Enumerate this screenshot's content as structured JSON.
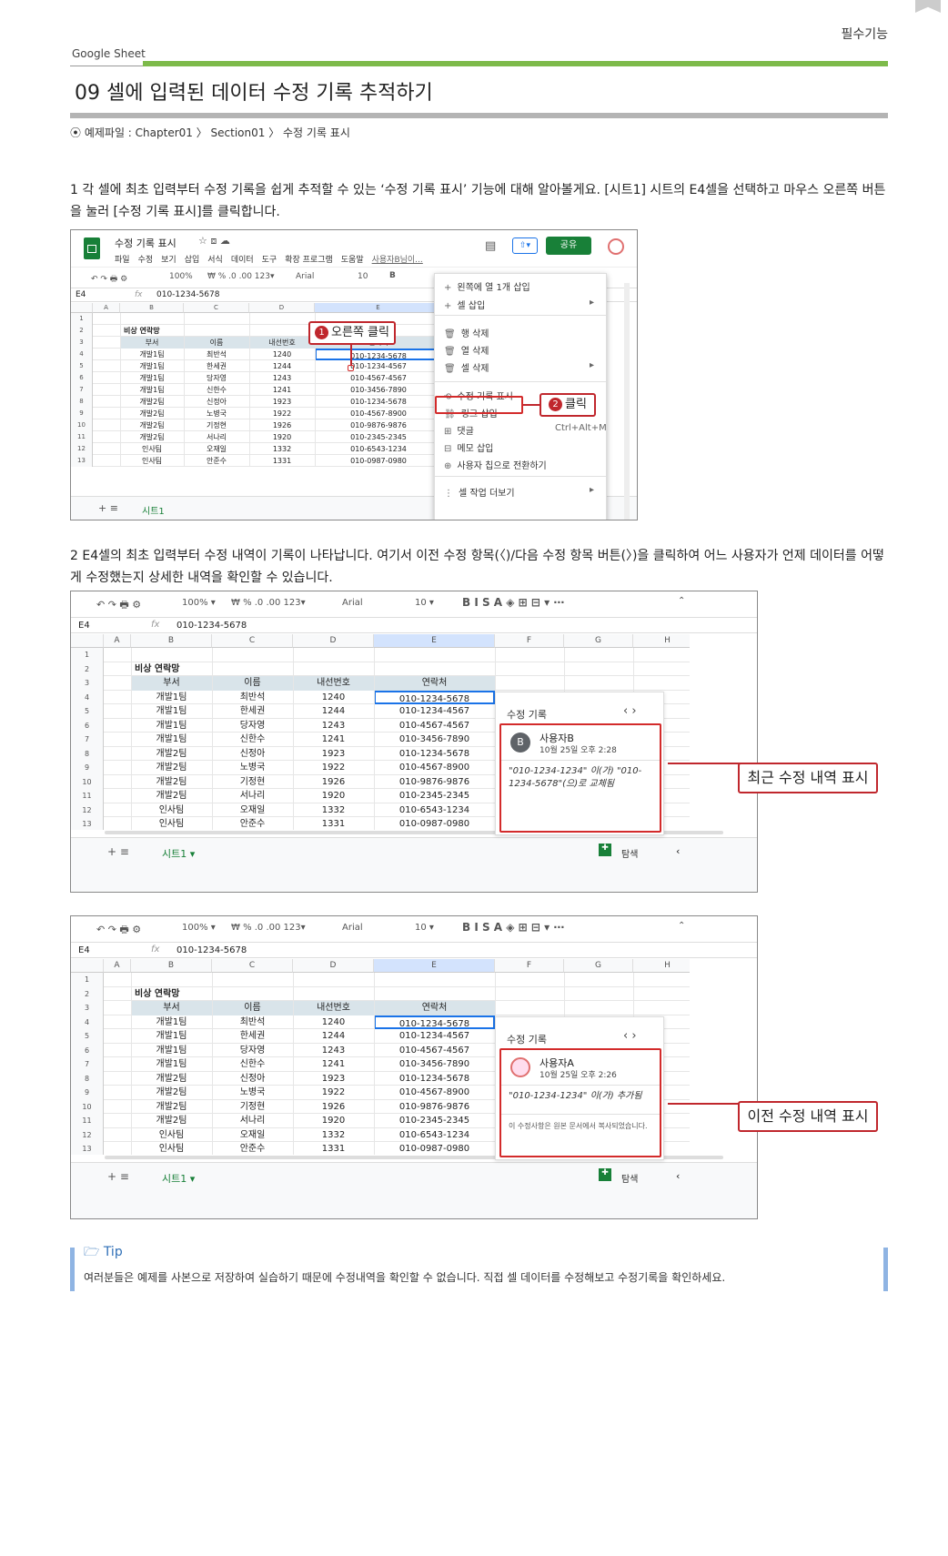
{
  "header": {
    "section": "필수기능",
    "category": "Google Sheet",
    "title": "09 셀에 입력된 데이터 수정 기록 추적하기",
    "example_file": "예제파일 : Chapter01 〉 Section01 〉 수정 기록 표시"
  },
  "step1": {
    "text": "1 각 셀에 최초 입력부터 수정 기록을 쉽게 추적할 수 있는 ‘수정 기록 표시’ 기능에 대해 알아볼게요. [시트1] 시트의 E4셀을 선택하고 마우스 오른쪽 버튼을 눌러 [수정 기록 표시]를 클릭합니다."
  },
  "step2": {
    "text": "2 E4셀의 최초 입력부터 수정 내역이 기록이 나타납니다. 여기서 이전 수정 항목(〈)/다음 수정 항목 버튼(〉)을 클릭하여 어느 사용자가 언제 데이터를 어떻게 수정했는지 상세한 내역을 확인할 수 있습니다."
  },
  "shot1": {
    "doc_title": "수정 기록 표시",
    "menus": [
      "파일",
      "수정",
      "보기",
      "삽입",
      "서식",
      "데이터",
      "도구",
      "확장 프로그램",
      "도움말",
      "사용자B님이..."
    ],
    "share": "공유",
    "cell_ref": "E4",
    "formula": "010-1234-5678",
    "zoom": "100%",
    "font": "Arial",
    "size": "10",
    "sheet_tab": "시트1",
    "context_menu": [
      "왼쪽에 열 1개 삽입",
      "셀 삽입",
      "행 삭제",
      "열 삭제",
      "셀 삭제",
      "수정 기록 표시",
      "링크 삽입",
      "댓글",
      "메모 삽입",
      "사용자 칩으로 전환하기",
      "셀 작업 더보기"
    ],
    "comment_shortcut": "Ctrl+Alt+M",
    "callout1": "오른쪽 클릭",
    "callout2": "클릭",
    "num1": "1",
    "num2": "2"
  },
  "sheet": {
    "title": "비상 연락망",
    "headers": [
      "부서",
      "이름",
      "내선번호",
      "연락처"
    ],
    "col_letters": [
      "A",
      "B",
      "C",
      "D",
      "E",
      "F",
      "G",
      "H"
    ],
    "rows": [
      [
        "개발1팀",
        "최반석",
        "1240",
        "010-1234-5678"
      ],
      [
        "개발1팀",
        "한세권",
        "1244",
        "010-1234-4567"
      ],
      [
        "개발1팀",
        "당자영",
        "1243",
        "010-4567-4567"
      ],
      [
        "개발1팀",
        "신한수",
        "1241",
        "010-3456-7890"
      ],
      [
        "개발2팀",
        "신정아",
        "1923",
        "010-1234-5678"
      ],
      [
        "개발2팀",
        "노병국",
        "1922",
        "010-4567-8900"
      ],
      [
        "개발2팀",
        "기정현",
        "1926",
        "010-9876-9876"
      ],
      [
        "개발2팀",
        "서나리",
        "1920",
        "010-2345-2345"
      ],
      [
        "인사팀",
        "오재일",
        "1332",
        "010-6543-1234"
      ],
      [
        "인사팀",
        "안준수",
        "1331",
        "010-0987-0980"
      ]
    ]
  },
  "shot2": {
    "panel_title": "수정 기록",
    "user": "사용자B",
    "avatar_letter": "B",
    "time": "10월 25일 오후 2:28",
    "change": "\"010-1234-1234\" 이(가) \"010-1234-5678\"(으)로 교체됨",
    "callout": "최근 수정 내역 표시",
    "explore": "탐색"
  },
  "shot3": {
    "panel_title": "수정 기록",
    "user": "사용자A",
    "time": "10월 25일 오후 2:26",
    "change": "\"010-1234-1234\" 이(가) 추가됨",
    "note": "이 수정사항은 원본 문서에서 복사되었습니다.",
    "callout": "이전 수정 내역 표시",
    "explore": "탐색"
  },
  "tip": {
    "label": "Tip",
    "text": "여러분들은 예제를 사본으로 저장하여 실습하기 때문에 수정내역을 확인할 수 없습니다. 직접 셀 데이터를 수정해보고 수정기록을 확인하세요."
  },
  "colors": {
    "green": "#7dba4a",
    "red": "#c0272d",
    "sheets_green": "#188038",
    "header_fill": "#d9e4ea"
  }
}
